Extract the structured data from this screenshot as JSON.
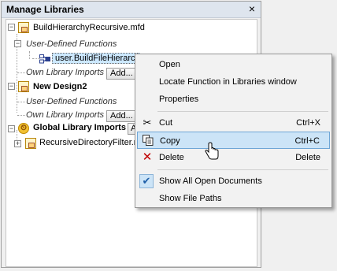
{
  "panel": {
    "title": "Manage Libraries",
    "close": "×"
  },
  "tree": {
    "doc1": {
      "name": "BuildHierarchyRecursive.mfd",
      "udf_label": "User-Defined Functions",
      "function_item": "user.BuildFileHierarchy",
      "imports_label": "Own Library Imports",
      "add_label": "Add..."
    },
    "doc2": {
      "name": "New Design2",
      "udf_label": "User-Defined Functions",
      "imports_label": "Own Library Imports",
      "add_label": "Add..."
    },
    "global": {
      "name": "Global Library Imports",
      "add_label": "Add...",
      "child": "RecursiveDirectoryFilter.mfd"
    }
  },
  "context_menu": {
    "items": [
      {
        "label": "Open",
        "shortcut": ""
      },
      {
        "label": "Locate Function in Libraries window",
        "shortcut": ""
      },
      {
        "label": "Properties",
        "shortcut": ""
      },
      {
        "label": "Cut",
        "shortcut": "Ctrl+X",
        "icon": "scissors-icon"
      },
      {
        "label": "Copy",
        "shortcut": "Ctrl+C",
        "icon": "copy-icon"
      },
      {
        "label": "Delete",
        "shortcut": "Delete",
        "icon": "delete-icon"
      },
      {
        "label": "Show All Open Documents",
        "shortcut": "",
        "checked": true
      },
      {
        "label": "Show File Paths",
        "shortcut": ""
      }
    ]
  },
  "colors": {
    "highlight": "#cce4f7",
    "selection": "#cce8ff",
    "delete_red": "#c00000"
  }
}
